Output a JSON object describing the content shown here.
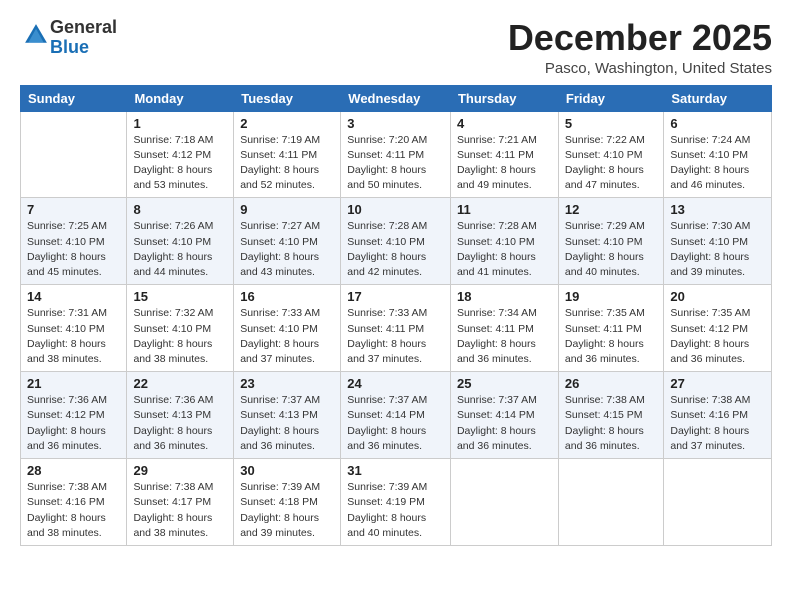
{
  "header": {
    "logo_general": "General",
    "logo_blue": "Blue",
    "month_title": "December 2025",
    "location": "Pasco, Washington, United States"
  },
  "days_of_week": [
    "Sunday",
    "Monday",
    "Tuesday",
    "Wednesday",
    "Thursday",
    "Friday",
    "Saturday"
  ],
  "weeks": [
    [
      {
        "day": "",
        "sunrise": "",
        "sunset": "",
        "daylight": ""
      },
      {
        "day": "1",
        "sunrise": "Sunrise: 7:18 AM",
        "sunset": "Sunset: 4:12 PM",
        "daylight": "Daylight: 8 hours and 53 minutes."
      },
      {
        "day": "2",
        "sunrise": "Sunrise: 7:19 AM",
        "sunset": "Sunset: 4:11 PM",
        "daylight": "Daylight: 8 hours and 52 minutes."
      },
      {
        "day": "3",
        "sunrise": "Sunrise: 7:20 AM",
        "sunset": "Sunset: 4:11 PM",
        "daylight": "Daylight: 8 hours and 50 minutes."
      },
      {
        "day": "4",
        "sunrise": "Sunrise: 7:21 AM",
        "sunset": "Sunset: 4:11 PM",
        "daylight": "Daylight: 8 hours and 49 minutes."
      },
      {
        "day": "5",
        "sunrise": "Sunrise: 7:22 AM",
        "sunset": "Sunset: 4:10 PM",
        "daylight": "Daylight: 8 hours and 47 minutes."
      },
      {
        "day": "6",
        "sunrise": "Sunrise: 7:24 AM",
        "sunset": "Sunset: 4:10 PM",
        "daylight": "Daylight: 8 hours and 46 minutes."
      }
    ],
    [
      {
        "day": "7",
        "sunrise": "Sunrise: 7:25 AM",
        "sunset": "Sunset: 4:10 PM",
        "daylight": "Daylight: 8 hours and 45 minutes."
      },
      {
        "day": "8",
        "sunrise": "Sunrise: 7:26 AM",
        "sunset": "Sunset: 4:10 PM",
        "daylight": "Daylight: 8 hours and 44 minutes."
      },
      {
        "day": "9",
        "sunrise": "Sunrise: 7:27 AM",
        "sunset": "Sunset: 4:10 PM",
        "daylight": "Daylight: 8 hours and 43 minutes."
      },
      {
        "day": "10",
        "sunrise": "Sunrise: 7:28 AM",
        "sunset": "Sunset: 4:10 PM",
        "daylight": "Daylight: 8 hours and 42 minutes."
      },
      {
        "day": "11",
        "sunrise": "Sunrise: 7:28 AM",
        "sunset": "Sunset: 4:10 PM",
        "daylight": "Daylight: 8 hours and 41 minutes."
      },
      {
        "day": "12",
        "sunrise": "Sunrise: 7:29 AM",
        "sunset": "Sunset: 4:10 PM",
        "daylight": "Daylight: 8 hours and 40 minutes."
      },
      {
        "day": "13",
        "sunrise": "Sunrise: 7:30 AM",
        "sunset": "Sunset: 4:10 PM",
        "daylight": "Daylight: 8 hours and 39 minutes."
      }
    ],
    [
      {
        "day": "14",
        "sunrise": "Sunrise: 7:31 AM",
        "sunset": "Sunset: 4:10 PM",
        "daylight": "Daylight: 8 hours and 38 minutes."
      },
      {
        "day": "15",
        "sunrise": "Sunrise: 7:32 AM",
        "sunset": "Sunset: 4:10 PM",
        "daylight": "Daylight: 8 hours and 38 minutes."
      },
      {
        "day": "16",
        "sunrise": "Sunrise: 7:33 AM",
        "sunset": "Sunset: 4:10 PM",
        "daylight": "Daylight: 8 hours and 37 minutes."
      },
      {
        "day": "17",
        "sunrise": "Sunrise: 7:33 AM",
        "sunset": "Sunset: 4:11 PM",
        "daylight": "Daylight: 8 hours and 37 minutes."
      },
      {
        "day": "18",
        "sunrise": "Sunrise: 7:34 AM",
        "sunset": "Sunset: 4:11 PM",
        "daylight": "Daylight: 8 hours and 36 minutes."
      },
      {
        "day": "19",
        "sunrise": "Sunrise: 7:35 AM",
        "sunset": "Sunset: 4:11 PM",
        "daylight": "Daylight: 8 hours and 36 minutes."
      },
      {
        "day": "20",
        "sunrise": "Sunrise: 7:35 AM",
        "sunset": "Sunset: 4:12 PM",
        "daylight": "Daylight: 8 hours and 36 minutes."
      }
    ],
    [
      {
        "day": "21",
        "sunrise": "Sunrise: 7:36 AM",
        "sunset": "Sunset: 4:12 PM",
        "daylight": "Daylight: 8 hours and 36 minutes."
      },
      {
        "day": "22",
        "sunrise": "Sunrise: 7:36 AM",
        "sunset": "Sunset: 4:13 PM",
        "daylight": "Daylight: 8 hours and 36 minutes."
      },
      {
        "day": "23",
        "sunrise": "Sunrise: 7:37 AM",
        "sunset": "Sunset: 4:13 PM",
        "daylight": "Daylight: 8 hours and 36 minutes."
      },
      {
        "day": "24",
        "sunrise": "Sunrise: 7:37 AM",
        "sunset": "Sunset: 4:14 PM",
        "daylight": "Daylight: 8 hours and 36 minutes."
      },
      {
        "day": "25",
        "sunrise": "Sunrise: 7:37 AM",
        "sunset": "Sunset: 4:14 PM",
        "daylight": "Daylight: 8 hours and 36 minutes."
      },
      {
        "day": "26",
        "sunrise": "Sunrise: 7:38 AM",
        "sunset": "Sunset: 4:15 PM",
        "daylight": "Daylight: 8 hours and 36 minutes."
      },
      {
        "day": "27",
        "sunrise": "Sunrise: 7:38 AM",
        "sunset": "Sunset: 4:16 PM",
        "daylight": "Daylight: 8 hours and 37 minutes."
      }
    ],
    [
      {
        "day": "28",
        "sunrise": "Sunrise: 7:38 AM",
        "sunset": "Sunset: 4:16 PM",
        "daylight": "Daylight: 8 hours and 38 minutes."
      },
      {
        "day": "29",
        "sunrise": "Sunrise: 7:38 AM",
        "sunset": "Sunset: 4:17 PM",
        "daylight": "Daylight: 8 hours and 38 minutes."
      },
      {
        "day": "30",
        "sunrise": "Sunrise: 7:39 AM",
        "sunset": "Sunset: 4:18 PM",
        "daylight": "Daylight: 8 hours and 39 minutes."
      },
      {
        "day": "31",
        "sunrise": "Sunrise: 7:39 AM",
        "sunset": "Sunset: 4:19 PM",
        "daylight": "Daylight: 8 hours and 40 minutes."
      },
      {
        "day": "",
        "sunrise": "",
        "sunset": "",
        "daylight": ""
      },
      {
        "day": "",
        "sunrise": "",
        "sunset": "",
        "daylight": ""
      },
      {
        "day": "",
        "sunrise": "",
        "sunset": "",
        "daylight": ""
      }
    ]
  ]
}
